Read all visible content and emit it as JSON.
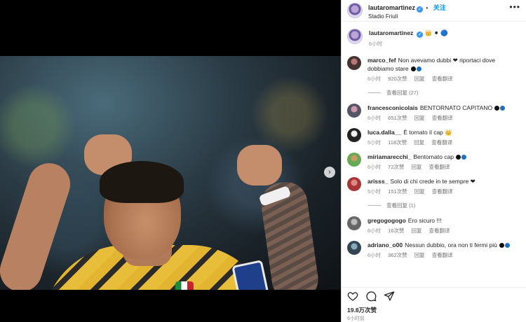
{
  "post": {
    "username": "lautaromartinez",
    "follow_label": "关注",
    "location": "Stadio Friuli",
    "more_label": "•••",
    "next_label": "›"
  },
  "caption": {
    "username": "lautaromartinez",
    "emojis": "👑 ⚫ 🔵",
    "time": "6小时"
  },
  "comments": [
    {
      "username": "marco_fef",
      "text": "Non avevamo dubbi ❤ riportaci dove dobbiamo stare",
      "time": "6小时",
      "likes": "920次赞",
      "reply": "回复",
      "translate": "查看翻译",
      "replies": "查看回复 (27)"
    },
    {
      "username": "francesconicolais",
      "text": "BENTORNATO CAPITANO",
      "time": "6小时",
      "likes": "651次赞",
      "reply": "回复",
      "translate": "查看翻译"
    },
    {
      "username": "luca.dalla__",
      "text": "È tornato il cap 👑",
      "time": "5小时",
      "likes": "118次赞",
      "reply": "回复",
      "translate": "查看翻译"
    },
    {
      "username": "miriamarecchi_",
      "text": "Bentornato cap",
      "time": "6小时",
      "likes": "72次赞",
      "reply": "回复",
      "translate": "查看翻译"
    },
    {
      "username": "arisss_",
      "text": "Solo di chi crede in te sempre ❤",
      "time": "5小时",
      "likes": "151次赞",
      "reply": "回复",
      "translate": "查看翻译",
      "replies": "查看回复 (1)"
    },
    {
      "username": "gregogogogo",
      "text": "Ero sicuro !!!",
      "time": "6小时",
      "likes": "16次赞",
      "reply": "回复",
      "translate": "查看翻译"
    },
    {
      "username": "adriano_o00",
      "text": "Nessun dubbio, ora non ti fermi più",
      "time": "6小时",
      "likes": "362次赞",
      "reply": "回复",
      "translate": "查看翻译"
    }
  ],
  "footer": {
    "likes": "19.8万次赞",
    "time": "6小时前"
  },
  "colors": {
    "accent": "#0095f6",
    "heart": "#ed4956",
    "muted": "#8e8e8e"
  }
}
